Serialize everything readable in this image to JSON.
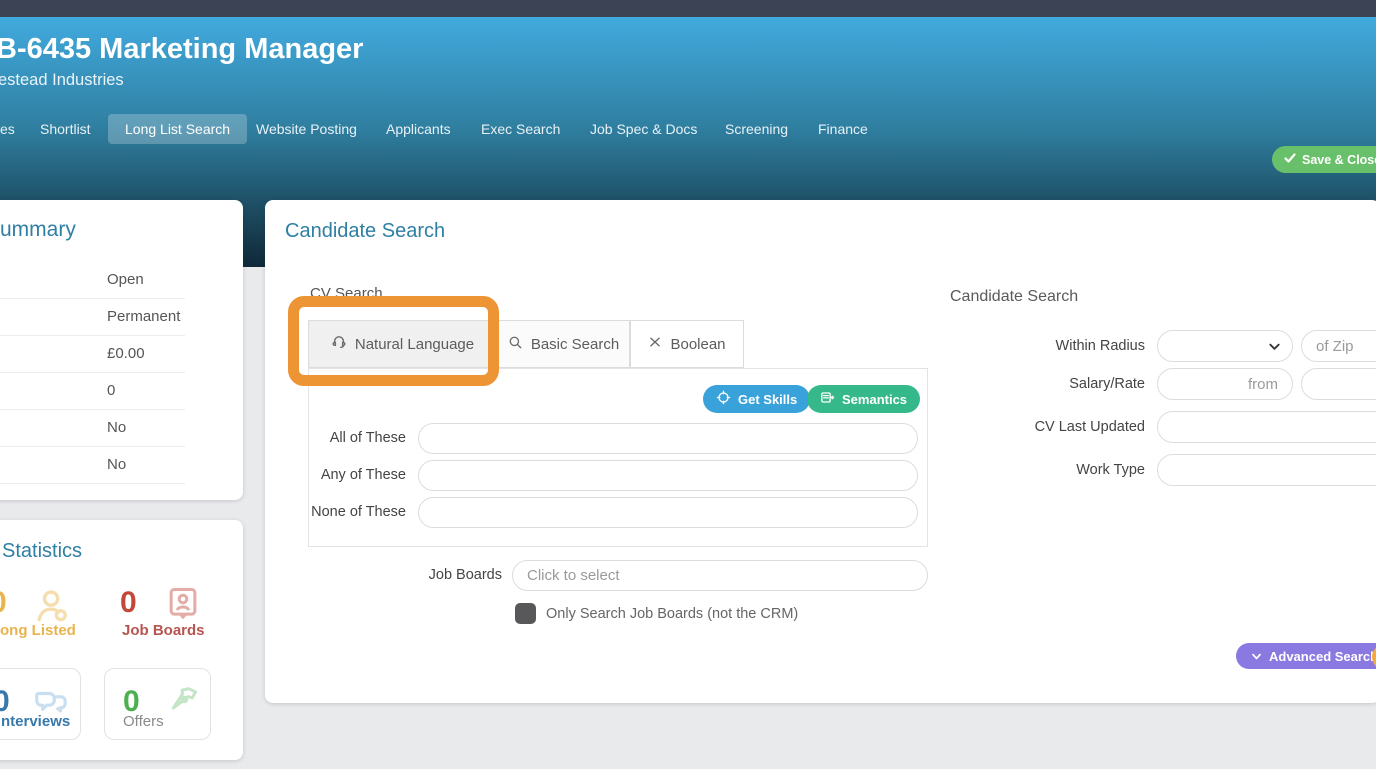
{
  "header": {
    "title": "B-6435 Marketing Manager",
    "subtitle": "estead Industries",
    "nav": [
      {
        "label": "es"
      },
      {
        "label": "Shortlist"
      },
      {
        "label": "Long List Search"
      },
      {
        "label": "Website Posting"
      },
      {
        "label": "Applicants"
      },
      {
        "label": "Exec Search"
      },
      {
        "label": "Job Spec & Docs"
      },
      {
        "label": "Screening"
      },
      {
        "label": "Finance"
      }
    ],
    "active_nav": "Long List Search",
    "save_close_label": "Save & Close"
  },
  "summary_panel": {
    "title": "ummary",
    "values": [
      "Open",
      "Permanent",
      "£0.00",
      "0",
      "No",
      "No"
    ]
  },
  "stats_panel": {
    "title": "Statistics",
    "items": [
      {
        "value": "0",
        "label": "ong Listed"
      },
      {
        "value": "0",
        "label": "Job Boards"
      },
      {
        "value": "0",
        "label": "nterviews"
      },
      {
        "value": "0",
        "label": "Offers"
      }
    ]
  },
  "candidate_search": {
    "title": "Candidate Search",
    "section_label": "CV Search",
    "tabs": [
      {
        "label": "Natural Language",
        "icon": "headset-icon"
      },
      {
        "label": "Basic Search",
        "icon": "search-icon"
      },
      {
        "label": "Boolean",
        "icon": "boolean-x-icon"
      }
    ],
    "get_skills_label": "Get Skills",
    "semantics_label": "Semantics",
    "field_labels": [
      "All of These",
      "Any of These",
      "None of These"
    ],
    "job_boards_label": "Job Boards",
    "job_boards_placeholder": "Click to select",
    "checkbox_label": "Only Search Job Boards (not the CRM)"
  },
  "filters": {
    "title": "Candidate Search",
    "within_radius_label": "Within Radius",
    "of_zip_placeholder": "of Zip",
    "salary_label": "Salary/Rate",
    "from_placeholder": "from",
    "cv_last_updated_label": "CV Last Updated",
    "work_type_label": "Work Type",
    "advanced_search_label": "Advanced Search"
  },
  "colors": {
    "accent_teal": "#2e7fa3",
    "save_green": "#69c06a",
    "get_skills_blue": "#3aa2da",
    "semantics_green": "#35b98b",
    "advanced_purple": "#8a79e0",
    "annotation_orange": "#ed9434",
    "stat_yellow": "#e9b44c",
    "stat_red": "#c2493a",
    "stat_blue": "#3879ab",
    "stat_green": "#4caf50"
  }
}
